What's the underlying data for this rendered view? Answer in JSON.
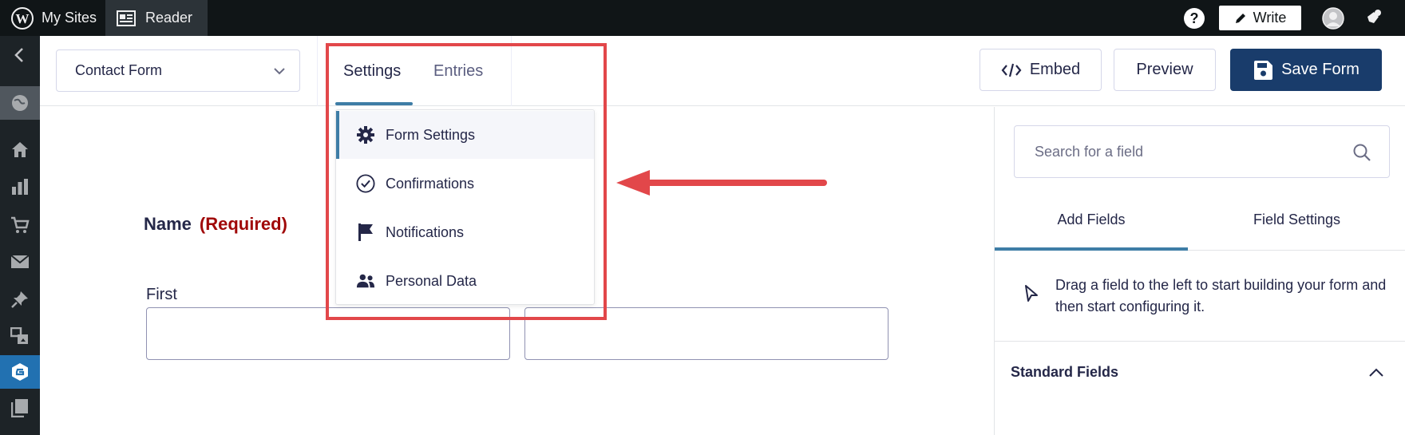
{
  "adminbar": {
    "my_sites": "My Sites",
    "reader": "Reader",
    "write": "Write"
  },
  "toolbar": {
    "form_name": "Contact Form",
    "tabs": [
      {
        "label": "Settings",
        "active": true
      },
      {
        "label": "Entries",
        "active": false
      }
    ],
    "embed": "Embed",
    "preview": "Preview",
    "save": "Save Form"
  },
  "settings_menu": {
    "items": [
      {
        "label": "Form Settings",
        "icon": "gear-icon",
        "active": true
      },
      {
        "label": "Confirmations",
        "icon": "check-circle-icon",
        "active": false
      },
      {
        "label": "Notifications",
        "icon": "flag-icon",
        "active": false
      },
      {
        "label": "Personal Data",
        "icon": "people-icon",
        "active": false
      }
    ]
  },
  "form": {
    "field_label": "Name",
    "required": "(Required)",
    "first_label": "First"
  },
  "right_panel": {
    "search_placeholder": "Search for a field",
    "tabs": [
      {
        "label": "Add Fields",
        "active": true
      },
      {
        "label": "Field Settings",
        "active": false
      }
    ],
    "hint": "Drag a field to the left to start building your form and then start configuring it.",
    "section_title": "Standard Fields"
  },
  "colors": {
    "admin_bar": "#101517",
    "sidebar": "#1d2327",
    "accent": "#3e7da6",
    "save_button": "#193c6b",
    "required": "#a00808",
    "annotation": "#e2474a"
  }
}
